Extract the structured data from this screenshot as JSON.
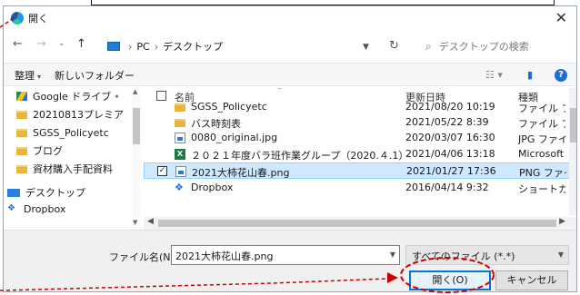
{
  "dialog": {
    "title": "開く",
    "close_glyph": "✕"
  },
  "address": {
    "back": "←",
    "forward": "→",
    "dropdown": "⌄",
    "up": "↑",
    "path": [
      "PC",
      "デスクトップ"
    ],
    "path_separator": "›",
    "refresh": "↻",
    "search_placeholder": "デスクトップの検索"
  },
  "toolbar": {
    "organize": "整理",
    "new_folder": "新しいフォルダー",
    "help": "?"
  },
  "navpane": {
    "items": [
      {
        "label": "Google ドライブ",
        "pin": "✦",
        "icon": "google-drive-icon"
      },
      {
        "label": "20210813プレミア",
        "icon": "folder-icon"
      },
      {
        "label": "SGSS_Policyetc",
        "icon": "folder-icon"
      },
      {
        "label": "ブログ",
        "icon": "folder-icon"
      },
      {
        "label": "資材購入手配資料",
        "icon": "folder-icon"
      },
      {
        "label": "デスクトップ",
        "icon": "desktop-icon"
      },
      {
        "label": "Dropbox",
        "icon": "dropbox-icon"
      }
    ]
  },
  "files": {
    "columns": {
      "name": "名前",
      "date": "更新日時",
      "type": "種類"
    },
    "rows": [
      {
        "name": "SGSS_Policyetc",
        "date": "2021/08/20 10:19",
        "type": "ファイル フォルダー",
        "icon": "folder-icon",
        "selected": false
      },
      {
        "name": "バス時刻表",
        "date": "2021/05/22 8:39",
        "type": "ファイル フォルダー",
        "icon": "folder-icon",
        "selected": false
      },
      {
        "name": "0080_original.jpg",
        "date": "2020/03/07 16:30",
        "type": "JPG ファイル",
        "icon": "image-file-icon",
        "selected": false
      },
      {
        "name": "２０２１年度バラ班作業グループ（2020.４.1）.xlsx",
        "date": "2021/04/06 13:18",
        "type": "Microsoft Excel",
        "icon": "excel-file-icon",
        "selected": false
      },
      {
        "name": "2021大柿花山春.png",
        "date": "2021/01/27 17:36",
        "type": "PNG ファイル",
        "icon": "image-file-icon",
        "selected": true
      },
      {
        "name": "Dropbox",
        "date": "2016/04/14 9:32",
        "type": "ショートカット",
        "icon": "dropbox-icon",
        "selected": false
      }
    ]
  },
  "bottom": {
    "filename_label": "ファイル名(N):",
    "filename_value": "2021大柿花山春.png",
    "filetype": "すべてのファイル (*.*)",
    "open_button": "開く(O)",
    "cancel_button": "キャンセル"
  },
  "colors": {
    "accent": "#0078d7",
    "selection": "#cde8ff",
    "annotation": "#cc0000"
  }
}
